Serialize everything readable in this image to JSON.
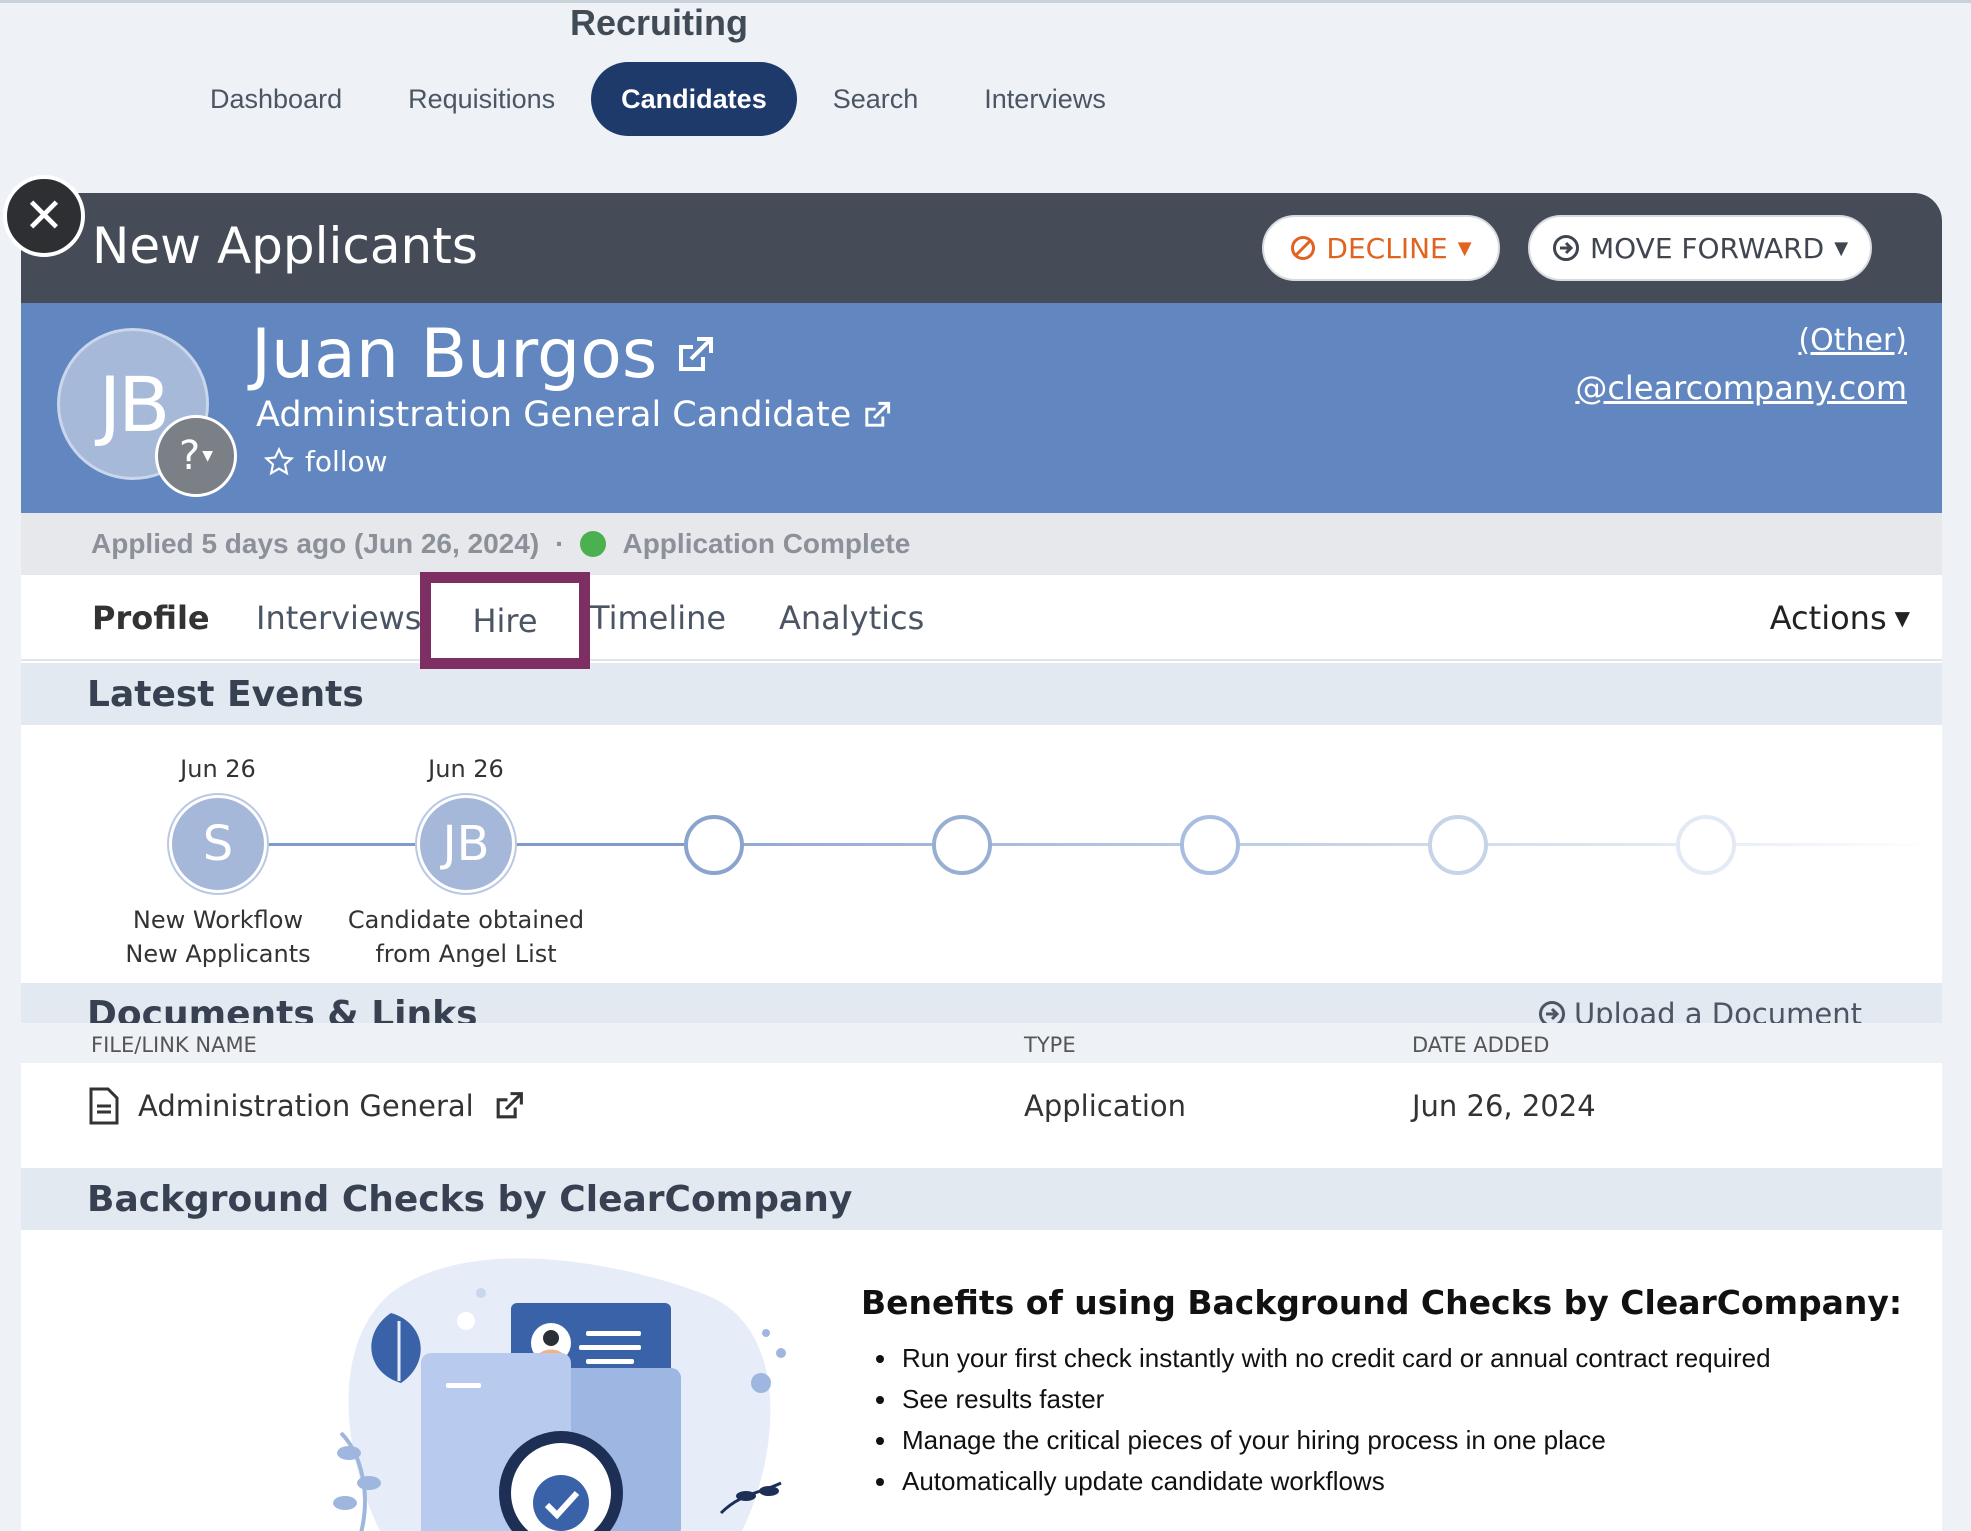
{
  "app": {
    "title": "Recruiting"
  },
  "nav": {
    "items": [
      {
        "label": "Dashboard",
        "active": false
      },
      {
        "label": "Requisitions",
        "active": false
      },
      {
        "label": "Candidates",
        "active": true
      },
      {
        "label": "Search",
        "active": false
      },
      {
        "label": "Interviews",
        "active": false
      }
    ]
  },
  "panel": {
    "title": "New Applicants",
    "decline_label": "DECLINE",
    "move_forward_label": "MOVE FORWARD"
  },
  "candidate": {
    "initials": "JB",
    "badge": "?",
    "name": "Juan Burgos",
    "role": "Administration General Candidate",
    "follow_label": "follow",
    "contact_type": "(Other)",
    "email": "@clearcompany.com"
  },
  "status": {
    "applied": "Applied 5 days ago (Jun 26, 2024)",
    "separator": "·",
    "application_status": "Application Complete",
    "status_color": "#4caf50"
  },
  "tabs": {
    "profile": "Profile",
    "interviews": "Interviews",
    "hire": "Hire",
    "timeline": "Timeline",
    "analytics": "Analytics",
    "actions": "Actions"
  },
  "latest_events": {
    "title": "Latest Events",
    "events": [
      {
        "date": "Jun 26",
        "initials": "S",
        "label_line1": "New Workflow",
        "label_line2": "New Applicants"
      },
      {
        "date": "Jun 26",
        "initials": "JB",
        "label_line1": "Candidate obtained",
        "label_line2": "from Angel List"
      }
    ]
  },
  "documents": {
    "title": "Documents & Links",
    "upload_label": "Upload a Document",
    "columns": {
      "name": "FILE/LINK NAME",
      "type": "TYPE",
      "date": "DATE ADDED"
    },
    "rows": [
      {
        "name": "Administration General",
        "type": "Application",
        "date": "Jun 26, 2024"
      }
    ]
  },
  "background_checks": {
    "title": "Background Checks by ClearCompany",
    "benefits_title": "Benefits of using Background Checks by ClearCompany:",
    "benefits": [
      "Run your first check instantly with no credit card or annual contract required",
      "See results faster",
      "Manage the critical pieces of your hiring process in one place",
      "Automatically update candidate workflows"
    ]
  },
  "colors": {
    "nav_active": "#1e3a6b",
    "header_dark": "#454c57",
    "candidate_band": "#6186c0",
    "decline": "#e0631f",
    "highlight_box": "#7d2f63"
  }
}
